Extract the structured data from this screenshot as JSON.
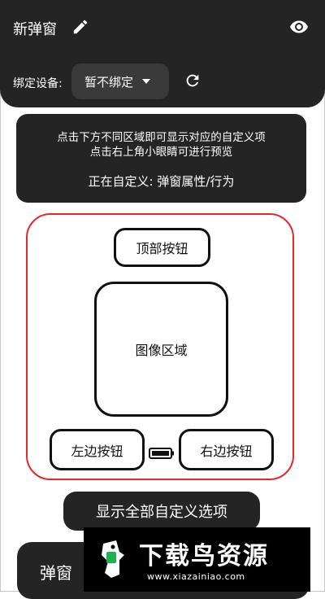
{
  "header": {
    "title": "新弹窗",
    "edit_icon": "pencil-icon",
    "preview_icon": "eye-icon"
  },
  "device": {
    "label": "绑定设备:",
    "selected": "暂不绑定",
    "refresh_icon": "refresh-icon"
  },
  "hint": {
    "line1": "点击下方不同区域即可显示对应的自定义项",
    "line2": "点击右上角小眼睛可进行预览",
    "current": "正在自定义: 弹窗属性/行为"
  },
  "preview": {
    "top_button": "顶部按钮",
    "image_area": "图像区域",
    "left_button": "左边按钮",
    "right_button": "右边按钮"
  },
  "show_all_button": "显示全部自定义选项",
  "bottom_section_title": "弹窗",
  "watermark": {
    "brand": "下载鸟资源",
    "url": "www.xiazainiao.com"
  },
  "colors": {
    "panel": "#242424",
    "preview_border": "#e8262e",
    "accent_green": "#1fb14f"
  }
}
